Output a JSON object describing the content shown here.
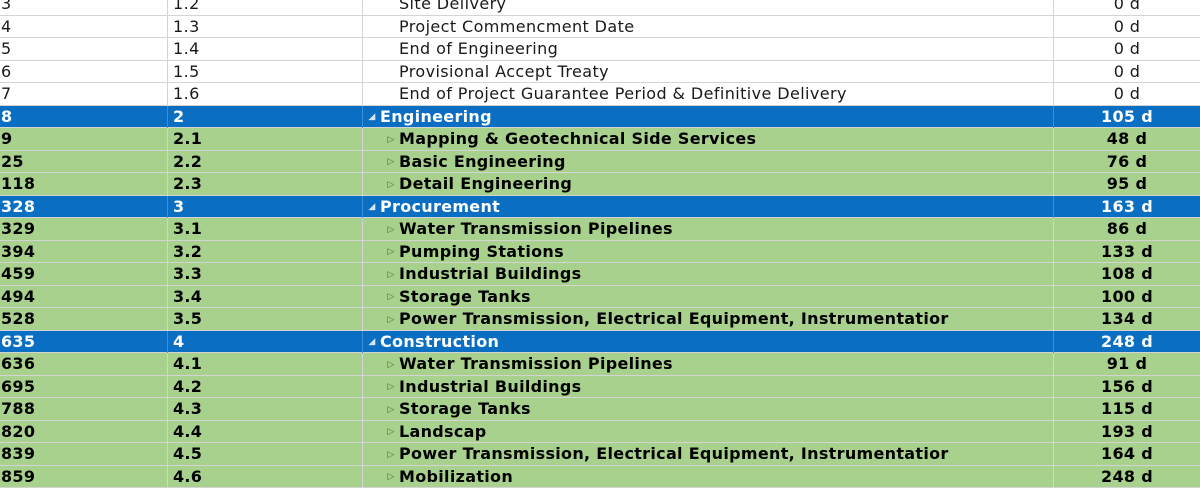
{
  "rows": [
    {
      "id": "3",
      "wbs": "1.2",
      "name": "Site Delivery",
      "duration": "0 d",
      "kind": "plain",
      "level": 1,
      "marker": ""
    },
    {
      "id": "4",
      "wbs": "1.3",
      "name": "Project Commencment Date",
      "duration": "0 d",
      "kind": "plain",
      "level": 1,
      "marker": ""
    },
    {
      "id": "5",
      "wbs": "1.4",
      "name": "End of Engineering",
      "duration": "0 d",
      "kind": "plain",
      "level": 1,
      "marker": ""
    },
    {
      "id": "6",
      "wbs": "1.5",
      "name": "Provisional Accept Treaty",
      "duration": "0 d",
      "kind": "plain",
      "level": 1,
      "marker": ""
    },
    {
      "id": "7",
      "wbs": "1.6",
      "name": "End of Project Guarantee Period & Definitive Delivery",
      "duration": "0 d",
      "kind": "plain",
      "level": 1,
      "marker": ""
    },
    {
      "id": "8",
      "wbs": "2",
      "name": "Engineering",
      "duration": "105 d",
      "kind": "summary",
      "level": 0,
      "marker": "◢"
    },
    {
      "id": "9",
      "wbs": "2.1",
      "name": "Mapping & Geotechnical Side Services",
      "duration": "48 d",
      "kind": "task",
      "level": 1,
      "marker": "▷"
    },
    {
      "id": "25",
      "wbs": "2.2",
      "name": "Basic Engineering",
      "duration": "76 d",
      "kind": "task",
      "level": 1,
      "marker": "▷"
    },
    {
      "id": "118",
      "wbs": "2.3",
      "name": "Detail Engineering",
      "duration": "95 d",
      "kind": "task",
      "level": 1,
      "marker": "▷"
    },
    {
      "id": "328",
      "wbs": "3",
      "name": "Procurement",
      "duration": "163 d",
      "kind": "summary",
      "level": 0,
      "marker": "◢"
    },
    {
      "id": "329",
      "wbs": "3.1",
      "name": "Water Transmission Pipelines",
      "duration": "86 d",
      "kind": "task",
      "level": 1,
      "marker": "▷"
    },
    {
      "id": "394",
      "wbs": "3.2",
      "name": "Pumping Stations",
      "duration": "133 d",
      "kind": "task",
      "level": 1,
      "marker": "▷"
    },
    {
      "id": "459",
      "wbs": "3.3",
      "name": "Industrial Buildings",
      "duration": "108 d",
      "kind": "task",
      "level": 1,
      "marker": "▷"
    },
    {
      "id": "494",
      "wbs": "3.4",
      "name": "Storage Tanks",
      "duration": "100 d",
      "kind": "task",
      "level": 1,
      "marker": "▷"
    },
    {
      "id": "528",
      "wbs": "3.5",
      "name": "Power Transmission, Electrical Equipment, Instrumentatior",
      "duration": "134 d",
      "kind": "task",
      "level": 1,
      "marker": "▷"
    },
    {
      "id": "635",
      "wbs": "4",
      "name": "Construction",
      "duration": "248 d",
      "kind": "summary",
      "level": 0,
      "marker": "◢"
    },
    {
      "id": "636",
      "wbs": "4.1",
      "name": "Water Transmission Pipelines",
      "duration": "91 d",
      "kind": "task",
      "level": 1,
      "marker": "▷"
    },
    {
      "id": "695",
      "wbs": "4.2",
      "name": "Industrial Buildings",
      "duration": "156 d",
      "kind": "task",
      "level": 1,
      "marker": "▷"
    },
    {
      "id": "788",
      "wbs": "4.3",
      "name": "Storage Tanks",
      "duration": "115 d",
      "kind": "task",
      "level": 1,
      "marker": "▷"
    },
    {
      "id": "820",
      "wbs": "4.4",
      "name": "Landscap",
      "duration": "193 d",
      "kind": "task",
      "level": 1,
      "marker": "▷"
    },
    {
      "id": "839",
      "wbs": "4.5",
      "name": "Power Transmission, Electrical Equipment, Instrumentatior",
      "duration": "164 d",
      "kind": "task",
      "level": 1,
      "marker": "▷"
    },
    {
      "id": "859",
      "wbs": "4.6",
      "name": "Mobilization",
      "duration": "248 d",
      "kind": "task",
      "level": 1,
      "marker": "▷"
    }
  ],
  "colors": {
    "summary_row": "#0a6fc2",
    "task_row": "#a9d18e",
    "plain_row": "#ffffff"
  },
  "icons": {
    "collapse": "collapse-triangle-icon",
    "expand": "expand-triangle-icon"
  }
}
